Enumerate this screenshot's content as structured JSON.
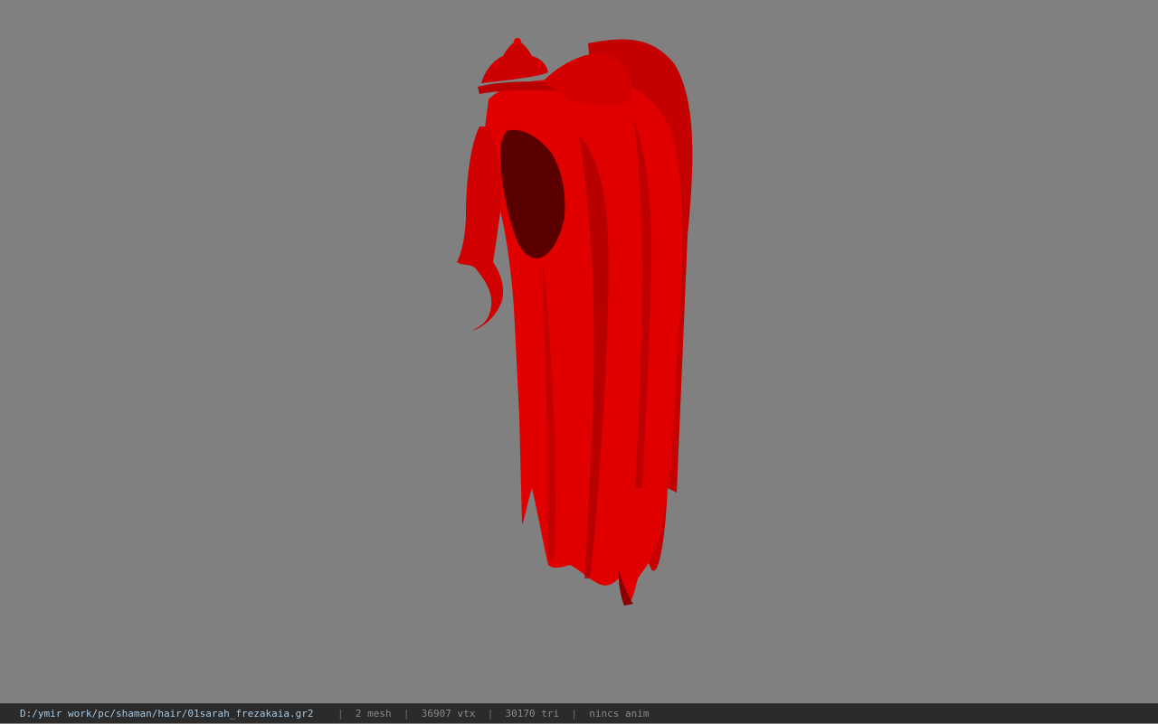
{
  "viewport": {
    "background_color": "#808080",
    "model": {
      "name": "01sarah_frezakaia",
      "base_color": "#e00000",
      "shadow_color": "#5a0000"
    }
  },
  "status_bar": {
    "file_path": "D:/ymir work/pc/shaman/hair/01sarah_frezakaia.gr2",
    "mesh_count": "2 mesh",
    "vertex_count": "36907 vtx",
    "triangle_count": "30170 tri",
    "anim_status": "nincs anim",
    "separator": "|"
  }
}
